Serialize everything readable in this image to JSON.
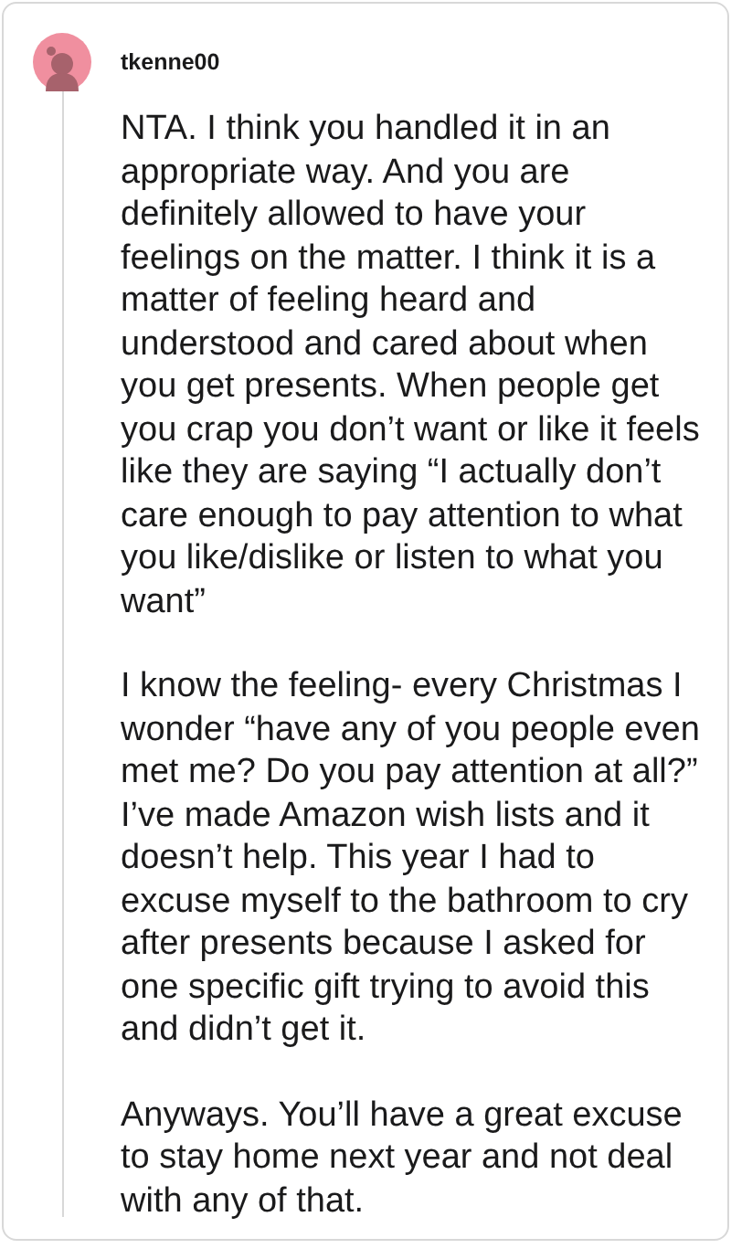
{
  "comment": {
    "username": "tkenne00",
    "paragraphs": [
      "NTA. I think you handled it in an appropriate way. And you are definitely allowed to have your feelings on the matter. I think it is a matter of feeling heard and understood and cared about when you get presents. When people get you crap you don’t want or like it feels like they are saying “I actually don’t care enough to pay attention to what you like/dislike or listen to what you want”",
      "I know the feeling- every Christmas I wonder “have any of you people even met me? Do you pay attention at all?” I’ve made Amazon wish lists and it doesn’t help. This year I had to excuse myself to the bathroom to cry after presents because I asked for one specific gift trying to avoid this and didn’t get it.",
      "Anyways. You’ll have a great excuse to stay home next year and not deal with any of that."
    ]
  }
}
